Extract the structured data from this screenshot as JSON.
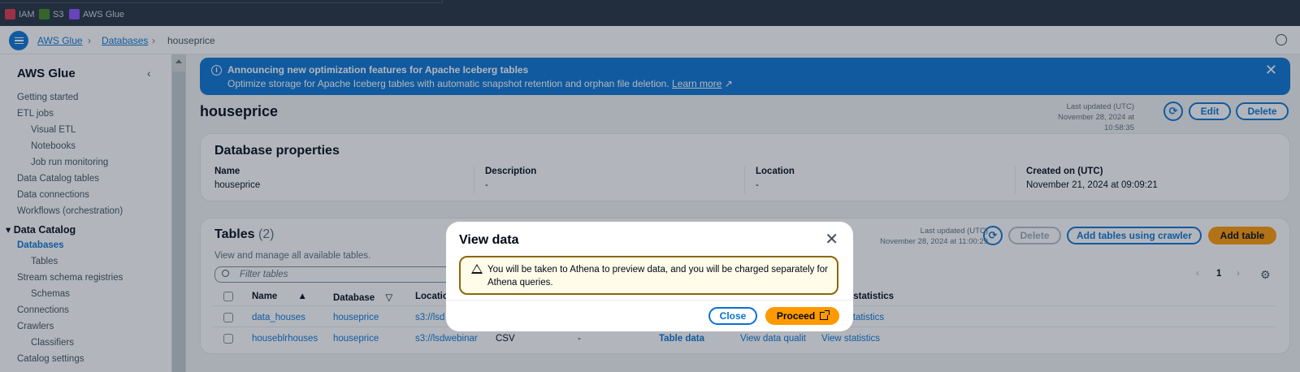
{
  "topbar": {
    "services": [
      {
        "label": "IAM",
        "icon": "iam-icon",
        "color": "#dd344c"
      },
      {
        "label": "S3",
        "icon": "s3-icon",
        "color": "#3f8624"
      },
      {
        "label": "AWS Glue",
        "icon": "glue-icon",
        "color": "#8c4fff"
      }
    ]
  },
  "breadcrumb": {
    "items": [
      "AWS Glue",
      "Databases"
    ],
    "current": "houseprice"
  },
  "sidebar": {
    "title": "AWS Glue",
    "items": [
      "Getting started",
      "ETL jobs",
      "Visual ETL",
      "Notebooks",
      "Job run monitoring",
      "Data Catalog tables",
      "Data connections",
      "Workflows (orchestration)"
    ],
    "section": "Data Catalog",
    "section_items": [
      "Databases",
      "Tables",
      "Stream schema registries",
      "Schemas",
      "Connections",
      "Crawlers",
      "Classifiers",
      "Catalog settings"
    ]
  },
  "flash": {
    "heading": "Announcing new optimization features for Apache Iceberg tables",
    "body": "Optimize storage for Apache Iceberg tables with automatic snapshot retention and orphan file deletion.",
    "link": "Learn more"
  },
  "page": {
    "title": "houseprice",
    "last_updated_label": "Last updated (UTC)",
    "last_updated_value": "November 28, 2024 at 10:58:35",
    "edit": "Edit",
    "delete": "Delete"
  },
  "properties": {
    "title": "Database properties",
    "name_label": "Name",
    "name_value": "houseprice",
    "desc_label": "Description",
    "desc_value": "-",
    "loc_label": "Location",
    "loc_value": "-",
    "created_label": "Created on (UTC)",
    "created_value": "November 21, 2024 at 09:09:21"
  },
  "tables": {
    "title": "Tables",
    "count": "(2)",
    "description": "View and manage all available tables.",
    "filter_placeholder": "Filter tables",
    "last_updated_label": "Last updated (UTC)",
    "last_updated_value": "November 28, 2024 at 11:00:29",
    "delete": "Delete",
    "add_crawler": "Add tables using crawler",
    "add_table": "Add table",
    "page": "1",
    "columns": {
      "name": "Name",
      "database": "Database",
      "location": "Location",
      "stats": "n statistics"
    },
    "rows": [
      {
        "name": "data_houses",
        "database": "houseprice",
        "location": "s3://lsd",
        "classification": "",
        "deprecated": "",
        "view": "",
        "quality": "",
        "stats": "statistics"
      },
      {
        "name": "houseblrhouses",
        "database": "houseprice",
        "location": "s3://lsdwebinar",
        "classification": "CSV",
        "deprecated": "-",
        "view": "Table data",
        "quality": "View data qualit",
        "stats": "View statistics"
      }
    ]
  },
  "modal": {
    "title": "View data",
    "alert": "You will be taken to Athena to preview data, and you will be charged separately for Athena queries.",
    "close": "Close",
    "proceed": "Proceed"
  },
  "colors": {
    "accent": "#0972d3",
    "primary_button": "#ff9900",
    "nav_bar": "#232f3e",
    "warning_border": "#8d6605"
  }
}
